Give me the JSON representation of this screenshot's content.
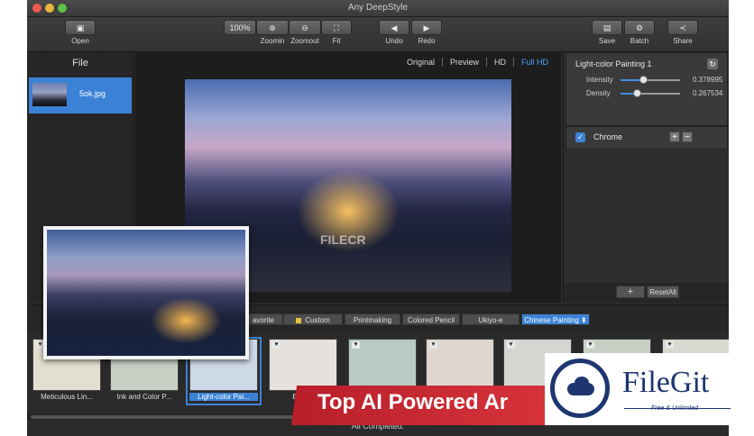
{
  "window": {
    "title": "Any DeepStyle"
  },
  "toolbar": {
    "open": "Open",
    "zoom_value": "100%",
    "zoomin": "Zoomin",
    "zoomout": "Zoomout",
    "fit": "Fit",
    "undo": "Undo",
    "redo": "Redo",
    "save": "Save",
    "batch": "Batch",
    "share": "Share"
  },
  "file_panel": {
    "title": "File",
    "files": [
      {
        "name": "5ok.jpg"
      }
    ]
  },
  "view_tabs": [
    "Original",
    "Preview",
    "HD",
    "Full HD"
  ],
  "active_view": "Full HD",
  "canvas": {
    "watermark": "FILECR"
  },
  "style_settings": {
    "name": "Light-color Painting 1",
    "intensity_label": "Intensity",
    "intensity_value": "0.378995",
    "intensity": 0.379,
    "density_label": "Density",
    "density_value": "0.267534",
    "density": 0.268,
    "chrome_label": "Chrome",
    "chrome_checked": true,
    "add": "+",
    "reset": "ResetAll"
  },
  "categories": [
    {
      "label": "avorite"
    },
    {
      "label": "Custom"
    },
    {
      "label": "Printmaking"
    },
    {
      "label": "Colored Pencil"
    },
    {
      "label": "Ukiyo-e"
    },
    {
      "label": "Chinese Painting"
    }
  ],
  "selected_category": "Chinese Painting",
  "styles": [
    {
      "label": "Meticulous Lin..."
    },
    {
      "label": "Ink and Color P..."
    },
    {
      "label": "Light-color Pai..."
    },
    {
      "label": "Bird-..."
    },
    {
      "label": ""
    },
    {
      "label": ""
    },
    {
      "label": ""
    },
    {
      "label": ""
    },
    {
      "label": ""
    }
  ],
  "status": "All Completed.",
  "banner": {
    "text": "Top AI Powered Ar"
  },
  "logo": {
    "name": "FileGit",
    "tagline": "Free & Unlimited"
  },
  "colors": {
    "accent": "#3b82d6",
    "banner": "#c8262f",
    "logo": "#1e3670"
  }
}
